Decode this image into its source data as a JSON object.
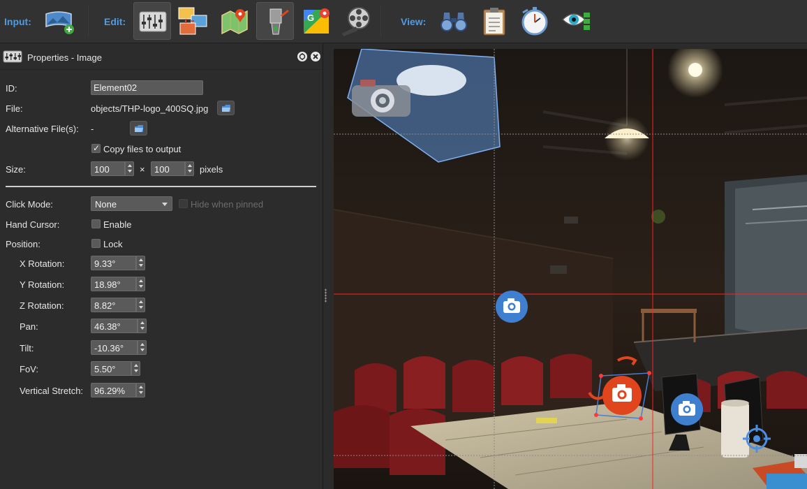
{
  "toolbar": {
    "input_label": "Input:",
    "edit_label": "Edit:",
    "view_label": "View:",
    "buttons": [
      {
        "name": "panorama-input",
        "icon": "panorama-add-icon"
      },
      {
        "name": "properties",
        "icon": "sliders-icon",
        "pressed": true
      },
      {
        "name": "tour-browser",
        "icon": "image-tree-icon"
      },
      {
        "name": "floor-plan",
        "icon": "map-pin-icon"
      },
      {
        "name": "patch-input",
        "icon": "paint-tool-icon",
        "pressed": true
      },
      {
        "name": "google-maps",
        "icon": "google-maps-icon"
      },
      {
        "name": "animation",
        "icon": "film-reel-icon"
      },
      {
        "name": "viewer",
        "icon": "binoculars-icon"
      },
      {
        "name": "tour-output",
        "icon": "clipboard-icon"
      },
      {
        "name": "speed",
        "icon": "stopwatch-icon"
      },
      {
        "name": "visibility",
        "icon": "eye-icon"
      }
    ]
  },
  "panel": {
    "title": "Properties - Image",
    "id_label": "ID:",
    "id_value": "Element02",
    "file_label": "File:",
    "file_value": "objects/THP-logo_400SQ.jpg",
    "alt_files_label": "Alternative File(s):",
    "alt_files_value": "-",
    "copy_files_label": "Copy files to output",
    "copy_files_checked": true,
    "size_label": "Size:",
    "width": "100",
    "size_times": "×",
    "height": "100",
    "size_unit": "pixels",
    "click_mode_label": "Click Mode:",
    "click_mode_value": "None",
    "hide_when_pinned_label": "Hide when pinned",
    "hand_cursor_label": "Hand Cursor:",
    "enable_label": "Enable",
    "position_label": "Position:",
    "lock_label": "Lock",
    "x_rotation_label": "X Rotation:",
    "x_rotation": "9.33°",
    "y_rotation_label": "Y Rotation:",
    "y_rotation": "18.98°",
    "z_rotation_label": "Z Rotation:",
    "z_rotation": "8.82°",
    "pan_label": "Pan:",
    "pan": "46.38°",
    "tilt_label": "Tilt:",
    "tilt": "-10.36°",
    "fov_label": "FoV:",
    "fov": "5.50°",
    "vstretch_label": "Vertical Stretch:",
    "vstretch": "96.29%"
  },
  "colors": {
    "accent": "#4d9de6",
    "guide_line": "#ff2020",
    "hotspot_blue": "#3f7fd0",
    "hotspot_selected": "#e0451e",
    "selection_polygon": "#5b8fd6"
  }
}
